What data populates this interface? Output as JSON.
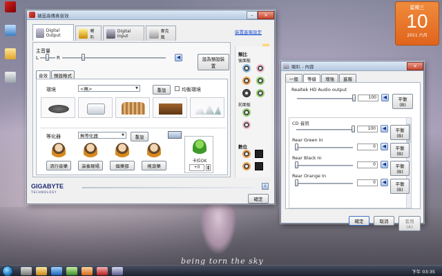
{
  "desktop": {
    "wallpaper_text": "being torn the sky",
    "calendar": {
      "weekday": "星期三",
      "day": "10",
      "year_month": "2011 六月"
    }
  },
  "main_window": {
    "title": "瑞昱高傳真音效",
    "tabs": [
      {
        "label": "Digital Output"
      },
      {
        "label": "喇叭"
      },
      {
        "label": "Digital Input"
      },
      {
        "label": "麥克風"
      }
    ],
    "advanced_link": "裝置進階設定",
    "main_volume": {
      "label": "主音量",
      "left": "L",
      "right": "R",
      "balance": 0.5,
      "level": 0.3
    },
    "default_device_button": "設為預設裝置",
    "sub_tabs": [
      "音效",
      "預設格式"
    ],
    "environment": {
      "label": "環境",
      "value": "<無>",
      "reset": "重設",
      "checkbox": "均衡環境"
    },
    "equalizer": {
      "label": "等化器",
      "value": "無等化器",
      "reset": "重設"
    },
    "presets": [
      "流行音樂",
      "演奏現場",
      "俱樂部",
      "搖滾樂"
    ],
    "karaoke": {
      "label": "卡拉OK",
      "value": "+0"
    },
    "analog": {
      "label": "類比",
      "back_panel": "後面板",
      "front_panel": "前面板"
    },
    "digital": {
      "label": "數位"
    },
    "brand": "GIGABYTE",
    "brand_sub": "TECHNOLOGY",
    "ok_button": "確定",
    "info_button": "i"
  },
  "props_window": {
    "title": "喇叭 - 內容",
    "tabs": [
      "一般",
      "等級",
      "增強",
      "進階"
    ],
    "channels": [
      {
        "name": "Realtek HD Audio output",
        "value": "100",
        "level": 1.0
      },
      {
        "name": "CD 音訊",
        "value": "100",
        "level": 1.0
      },
      {
        "name": "Rear Green In",
        "value": "0",
        "level": 0.0
      },
      {
        "name": "Rear Black In",
        "value": "0",
        "level": 0.0
      },
      {
        "name": "Rear Orange In",
        "value": "0",
        "level": 0.0
      }
    ],
    "balance_button": "平衡(B)",
    "ok": "確定",
    "cancel": "取消",
    "apply": "套用(A)"
  },
  "taskbar": {
    "clock": "下午 03:35"
  }
}
